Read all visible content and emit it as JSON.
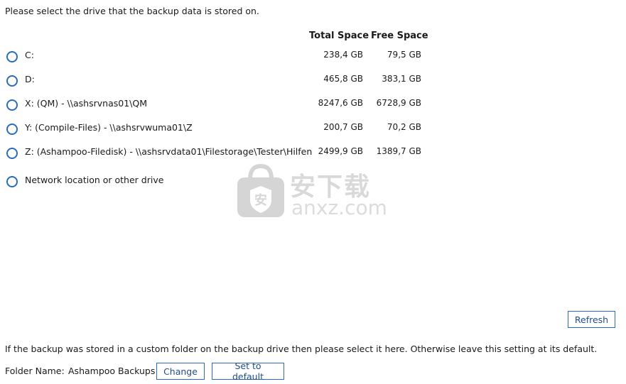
{
  "prompt_text": "Please select the drive that the backup data is stored on.",
  "columns": {
    "total": "Total Space",
    "free": "Free Space"
  },
  "drives": [
    {
      "label": "C:",
      "total": "238,4 GB",
      "free": "79,5 GB"
    },
    {
      "label": "D:",
      "total": "465,8 GB",
      "free": "383,1 GB"
    },
    {
      "label": "X:  (QM) - \\\\ashsrvnas01\\QM",
      "total": "8247,6 GB",
      "free": "6728,9 GB"
    },
    {
      "label": "Y:  (Compile-Files) - \\\\ashsrvwuma01\\Z",
      "total": "200,7 GB",
      "free": "70,2 GB"
    },
    {
      "label": "Z:  (Ashampoo-Filedisk) - \\\\ashsrvdata01\\Filestorage\\Tester\\Hilfen",
      "total": "2499,9 GB",
      "free": "1389,7 GB"
    }
  ],
  "network_option": "Network location or other drive",
  "watermark": {
    "cn": "安下载",
    "en": "anxz.com"
  },
  "buttons": {
    "refresh": "Refresh",
    "change": "Change",
    "set_default": "Set to default"
  },
  "custom_folder_note": "If the backup was stored in a custom folder on the backup drive then please select it here. Otherwise leave this setting at its default.",
  "folder": {
    "label": "Folder Name:",
    "value": "Ashampoo Backups"
  },
  "colors": {
    "accent": "#2a6bbf"
  }
}
